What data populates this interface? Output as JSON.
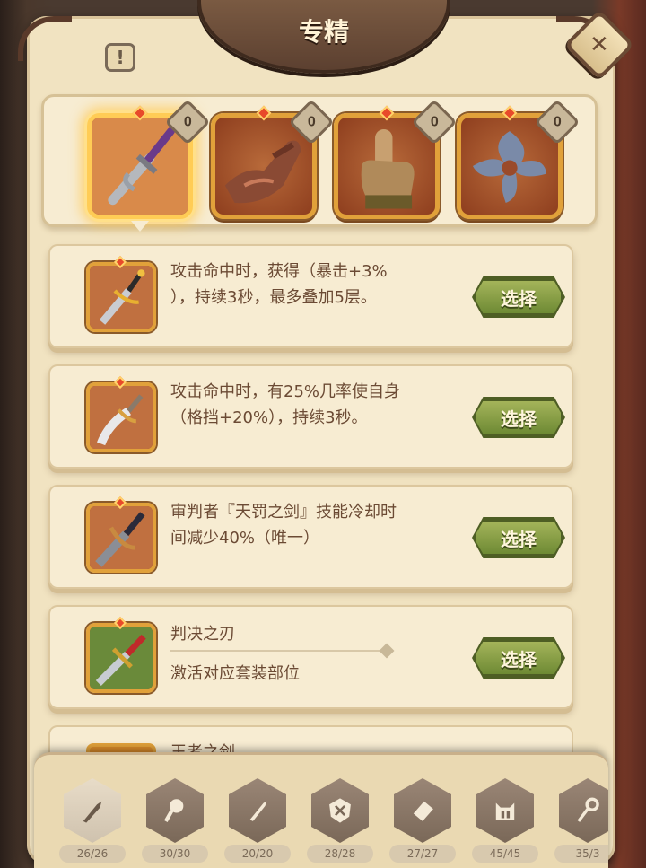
{
  "window": {
    "title": "专精"
  },
  "tabs": [
    {
      "name": "sword",
      "badge": "0",
      "selected": true
    },
    {
      "name": "gauntlet",
      "badge": "0",
      "selected": false
    },
    {
      "name": "finger",
      "badge": "0",
      "selected": false
    },
    {
      "name": "shuriken",
      "badge": "0",
      "selected": false
    }
  ],
  "options": [
    {
      "icon": "sword-gold-icon",
      "desc_line1": "攻击命中时，获得（暴击+3%",
      "desc_line2": "），持续3秒，最多叠加5层。",
      "button": "选择"
    },
    {
      "icon": "sword-curved-icon",
      "desc_line1": "攻击命中时，有25%几率使自身",
      "desc_line2": "（格挡+20%），持续3秒。",
      "button": "选择"
    },
    {
      "icon": "sword-dark-icon",
      "desc_line1": "审判者『天罚之剑』技能冷却时",
      "desc_line2": "间减少40%（唯一）",
      "button": "选择"
    },
    {
      "icon": "sword-red-icon",
      "name": "判决之刃",
      "sub": "激活对应套装部位",
      "button": "选择"
    }
  ],
  "partial_option": {
    "name": "王者之剑"
  },
  "bottom_bar": [
    {
      "icon": "sword-icon",
      "count": "26/26",
      "active": true
    },
    {
      "icon": "club-icon",
      "count": "30/30",
      "active": false
    },
    {
      "icon": "dagger-icon",
      "count": "20/20",
      "active": false
    },
    {
      "icon": "shield-icon",
      "count": "28/28",
      "active": false
    },
    {
      "icon": "book-icon",
      "count": "27/27",
      "active": false
    },
    {
      "icon": "helmet-icon",
      "count": "45/45",
      "active": false
    },
    {
      "icon": "staff-icon",
      "count": "35/3",
      "active": false
    }
  ],
  "colors": {
    "parchment": "#f1e3c1",
    "button_green": "#6e8a34",
    "text_brown": "#6b4a34",
    "frame_gold": "#e1a13a"
  }
}
